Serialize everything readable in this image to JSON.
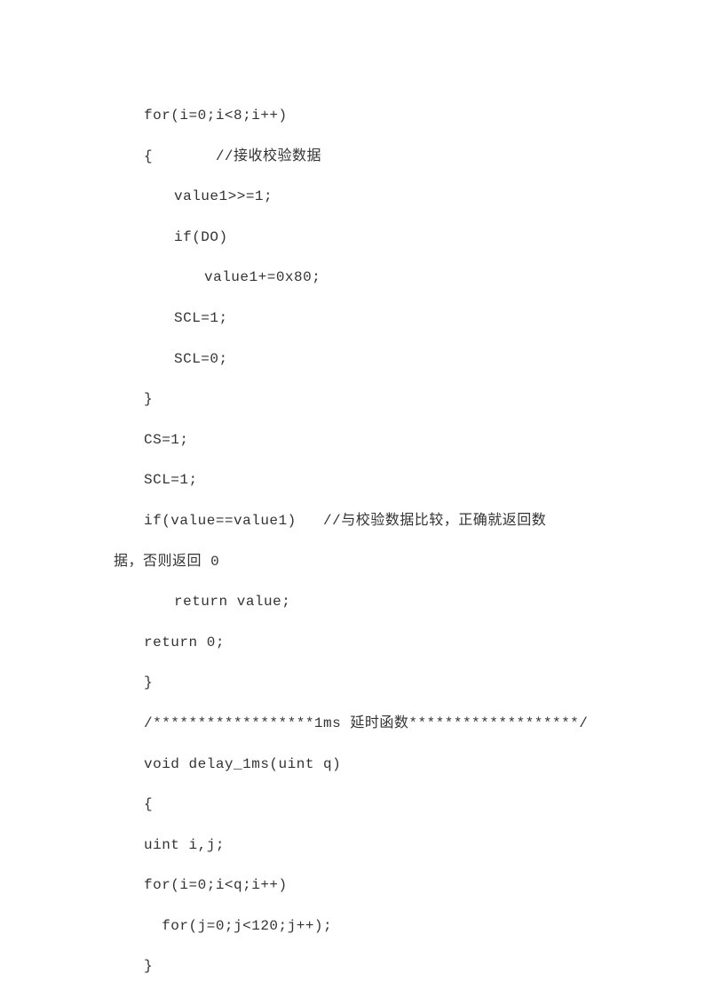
{
  "lines": {
    "l1": "for(i=0;i<8;i++)",
    "l2": "{       //接收校验数据",
    "l3": "value1>>=1;",
    "l4": "if(DO)",
    "l5": "value1+=0x80;",
    "l6": "SCL=1;",
    "l7": "SCL=0;",
    "l8": "}",
    "l9": "CS=1;",
    "l10": "SCL=1;",
    "l11": "if(value==value1)   //与校验数据比较，正确就返回数",
    "l11b": "据，否则返回 0",
    "l12": "return value;",
    "l13": "return 0;",
    "l14": "}",
    "l15": "/******************1ms 延时函数*******************/",
    "l16": "void delay_1ms(uint q)",
    "l17": "{",
    "l18": "uint i,j;",
    "l19": "for(i=0;i<q;i++)",
    "l20": "  for(j=0;j<120;j++);",
    "l21": "}"
  }
}
